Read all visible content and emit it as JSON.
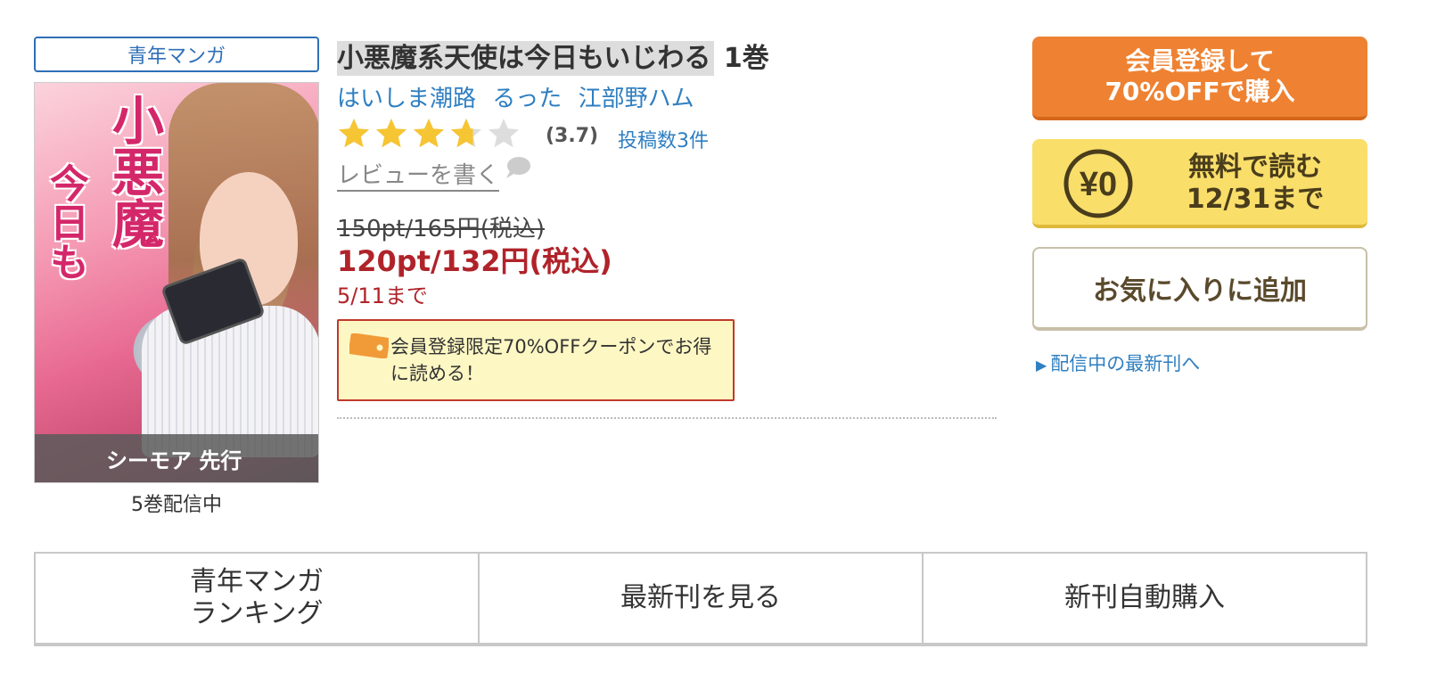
{
  "genre_badge": "青年マンガ",
  "cover": {
    "title_lines": [
      "小悪魔",
      "今日も"
    ],
    "footer_text": "シーモア 先行"
  },
  "volumes_available": "5巻配信中",
  "title": {
    "main": "小悪魔系天使は今日もいじわる",
    "volume": "1巻"
  },
  "authors": [
    "はいしま潮路",
    "るった",
    "江部野ハム"
  ],
  "rating": {
    "value": 3.7,
    "display": "(3.7)",
    "max_stars": 5,
    "review_count": "投稿数3件",
    "star_color": "#f6c533",
    "empty_star_color": "#dddddd"
  },
  "write_review": "レビューを書く",
  "price": {
    "original": "150pt/165円(税込)",
    "sale": "120pt/132円(税込)",
    "deadline": "5/11まで"
  },
  "coupon": {
    "text": "会員登録限定70%OFFクーポンでお得に読める！",
    "icon": "ticket-icon"
  },
  "buttons": {
    "register_purchase": "会員登録して\n70%OFFで購入",
    "free_read_line1": "無料で読む",
    "free_read_line2": "12/31まで",
    "free_icon_text": "¥0",
    "favorite": "お気に入りに追加"
  },
  "latest_link": "配信中の最新刊へ",
  "tabs": [
    {
      "label": "青年マンガ\nランキング"
    },
    {
      "label": "最新刊を見る"
    },
    {
      "label": "新刊自動購入"
    }
  ],
  "colors": {
    "accent_blue": "#2f7fc1",
    "price_red": "#b0232a",
    "register_orange": "#ee8232",
    "free_yellow": "#f9de6a"
  }
}
